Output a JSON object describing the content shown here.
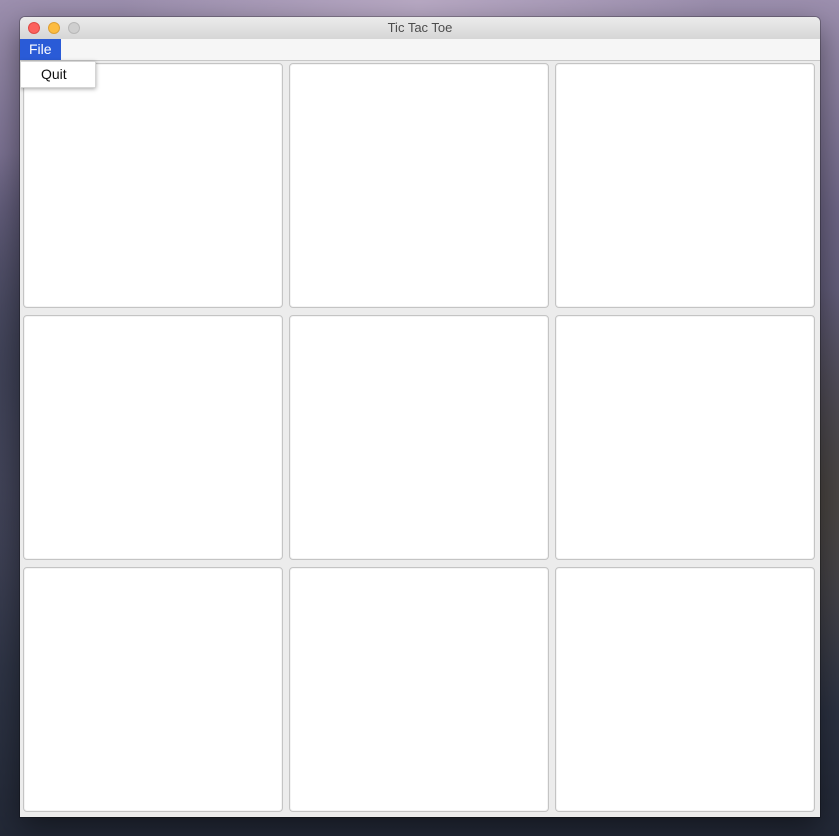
{
  "window": {
    "title": "Tic Tac Toe"
  },
  "traffic_lights": [
    "close-icon",
    "minimize-icon",
    "zoom-icon"
  ],
  "menubar": {
    "file_label": "File",
    "file_active_color": "#2a5bd7"
  },
  "file_menu": {
    "items": [
      {
        "label": "Quit"
      }
    ]
  },
  "board": {
    "rows": 3,
    "cols": 3,
    "cells": [
      "",
      "",
      "",
      "",
      "",
      "",
      "",
      "",
      ""
    ]
  }
}
